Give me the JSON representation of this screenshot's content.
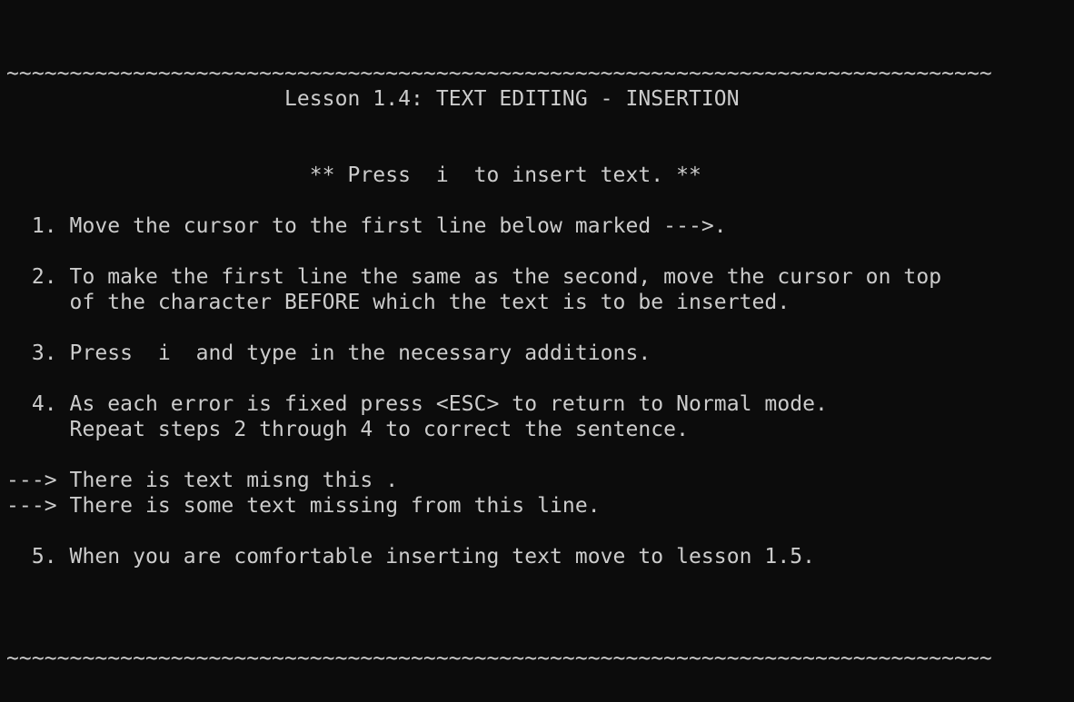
{
  "terminal": {
    "rule_top": "~~~~~~~~~~~~~~~~~~~~~~~~~~~~~~~~~~~~~~~~~~~~~~~~~~~~~~~~~~~~~~~~~~~~~~~~~~~~~~",
    "title": "                      Lesson 1.4: TEXT EDITING - INSERTION",
    "instruction": "                        ** Press  i  to insert text. **",
    "step1": "  1. Move the cursor to the first line below marked --->.",
    "step2_line1": "  2. To make the first line the same as the second, move the cursor on top",
    "step2_line2": "     of the character BEFORE which the text is to be inserted.",
    "step3": "  3. Press  i  and type in the necessary additions.",
    "step4_line1": "  4. As each error is fixed press <ESC> to return to Normal mode.",
    "step4_line2": "     Repeat steps 2 through 4 to correct the sentence.",
    "practice_line1": "---> There is text misng this .",
    "practice_line2": "---> There is some text missing from this line.",
    "step5": "  5. When you are comfortable inserting text move to lesson 1.5.",
    "rule_bottom": "~~~~~~~~~~~~~~~~~~~~~~~~~~~~~~~~~~~~~~~~~~~~~~~~~~~~~~~~~~~~~~~~~~~~~~~~~~~~~~"
  }
}
